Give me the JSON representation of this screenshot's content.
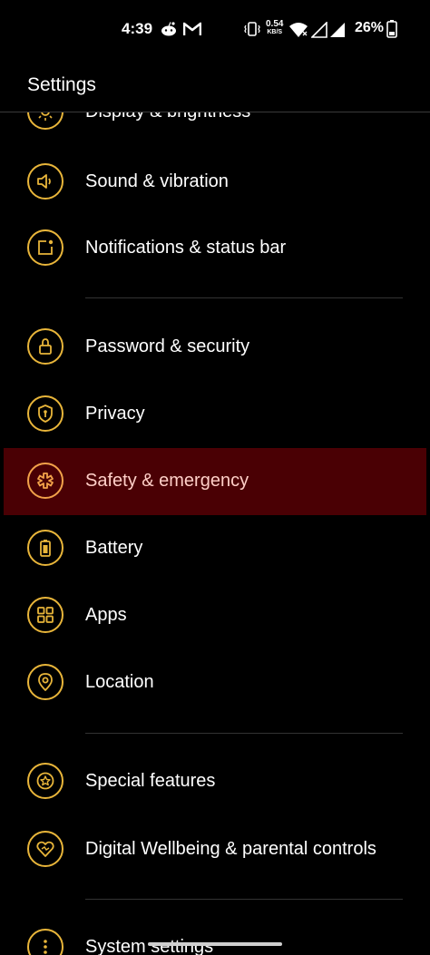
{
  "status_bar": {
    "time": "4:39",
    "net_speed_value": "0.54",
    "net_speed_unit": "KB/S",
    "battery_percent": "26%",
    "icons": [
      "reddit-icon",
      "gmail-icon",
      "vibrate-icon",
      "wifi-icon",
      "signal-icon",
      "signal-icon",
      "battery-icon"
    ]
  },
  "header": {
    "title": "Settings"
  },
  "accent_color": "#e8b53a",
  "highlight_color": "#4a0004",
  "settings": [
    {
      "label": "Display & brightness",
      "icon": "brightness-icon"
    },
    {
      "label": "Sound & vibration",
      "icon": "speaker-icon"
    },
    {
      "label": "Notifications & status bar",
      "icon": "notification-icon"
    },
    {
      "label": "Password & security",
      "icon": "lock-icon"
    },
    {
      "label": "Privacy",
      "icon": "shield-icon"
    },
    {
      "label": "Safety & emergency",
      "icon": "medical-star-icon",
      "highlighted": true
    },
    {
      "label": "Battery",
      "icon": "battery-icon"
    },
    {
      "label": "Apps",
      "icon": "apps-grid-icon"
    },
    {
      "label": "Location",
      "icon": "location-pin-icon"
    },
    {
      "label": "Special features",
      "icon": "star-icon"
    },
    {
      "label": "Digital Wellbeing & parental controls",
      "icon": "heart-icon"
    },
    {
      "label": "System settings",
      "icon": "more-vertical-icon"
    }
  ]
}
